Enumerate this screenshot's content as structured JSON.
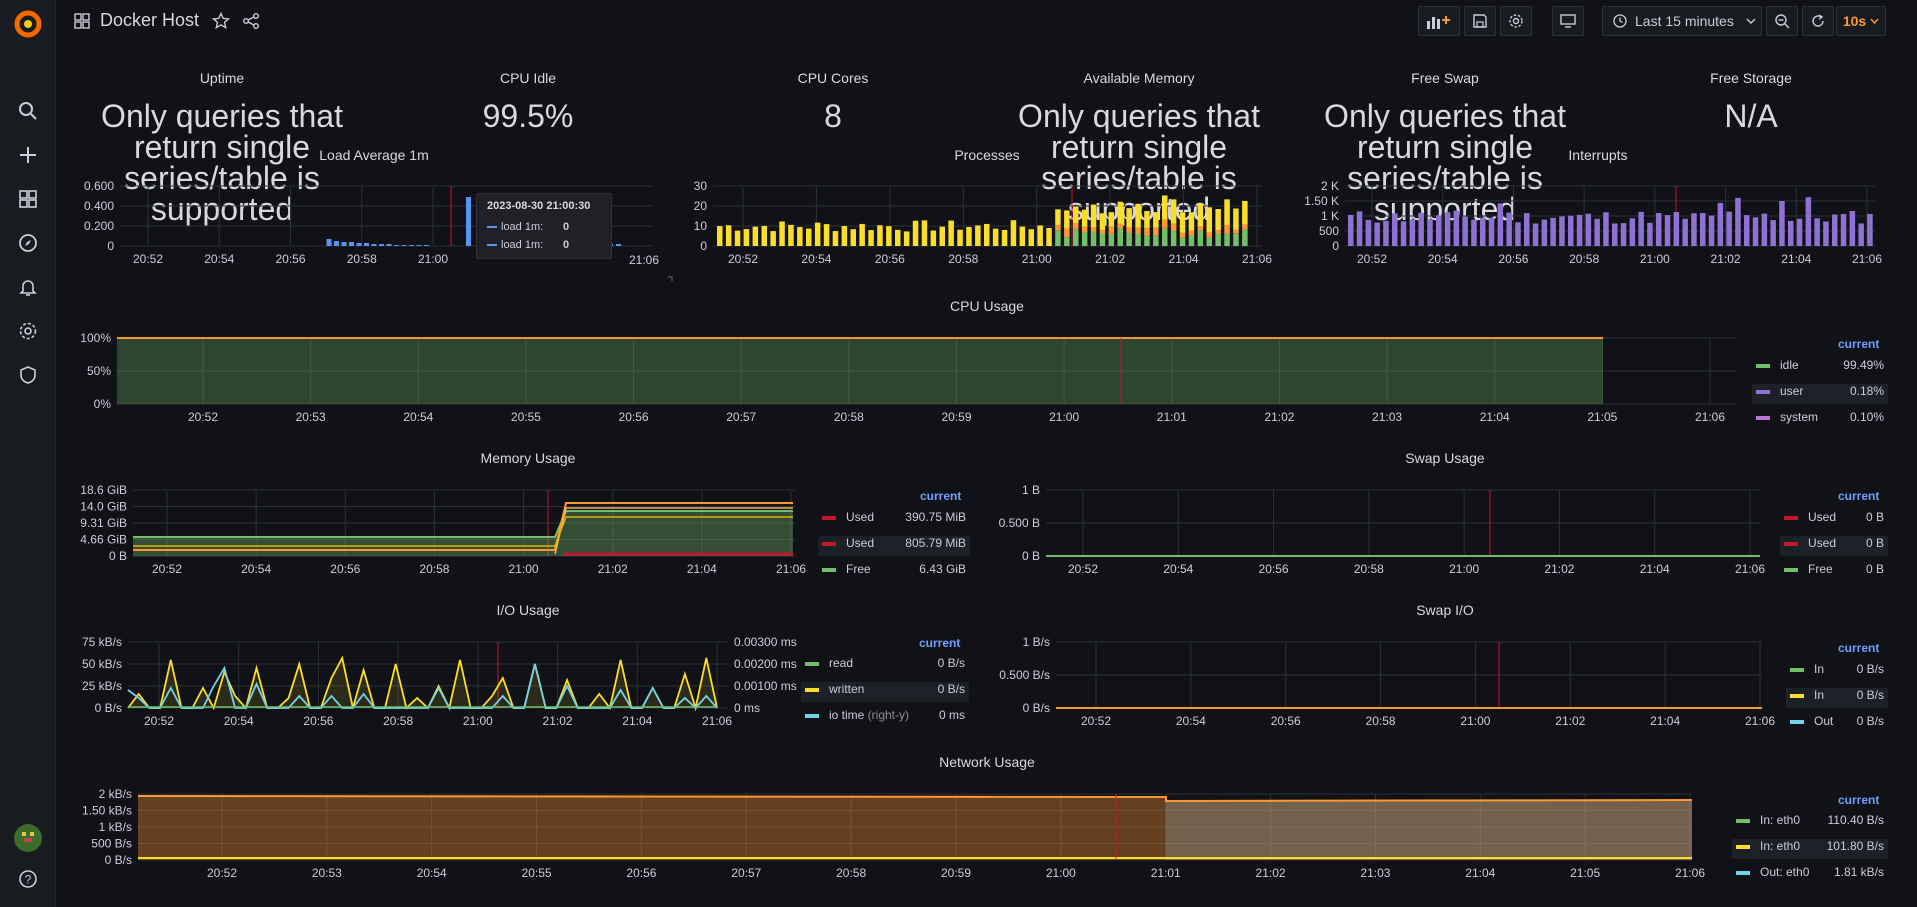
{
  "dashboard": {
    "title": "Docker Host"
  },
  "toolbar": {
    "time_range": "Last 15 minutes",
    "refresh": "10s"
  },
  "colors": {
    "green": "#73bf69",
    "yellow": "#fade2a",
    "orange": "#ff9830",
    "red": "#f2495c",
    "purple": "#8f71d1",
    "blue": "#5794f2",
    "cyan": "#8ab8ff",
    "magenta": "#b877d9",
    "darkred": "#c4162a"
  },
  "stats": {
    "uptime": {
      "title": "Uptime",
      "value": "Only queries that return single series/table is supported"
    },
    "cpu_idle": {
      "title": "CPU Idle",
      "value": "99.5%"
    },
    "cpu_cores": {
      "title": "CPU Cores",
      "value": "8"
    },
    "available_memory": {
      "title": "Available Memory",
      "value": "Only queries that return single series/table is supported"
    },
    "free_swap": {
      "title": "Free Swap",
      "value": "Only queries that return single series/table is supported"
    },
    "free_storage": {
      "title": "Free Storage",
      "value": "N/A"
    }
  },
  "load_panel": {
    "title": "Load Average 1m",
    "y_ticks": [
      "0.600",
      "0.400",
      "0.200",
      "0"
    ],
    "x_ticks": [
      "20:52",
      "20:54",
      "20:56",
      "20:58",
      "21:00"
    ],
    "tooltip": {
      "time": "2023-08-30 21:00:30",
      "rows": [
        {
          "label": "load 1m:",
          "value": "0"
        },
        {
          "label": "load 1m:",
          "value": "0"
        }
      ]
    }
  },
  "processes_panel": {
    "title": "Processes",
    "y_ticks": [
      "30",
      "20",
      "10",
      "0"
    ],
    "x_ticks": [
      "20:52",
      "20:54",
      "20:56",
      "20:58",
      "21:00",
      "21:02",
      "21:04",
      "21:06"
    ]
  },
  "interrupts_panel": {
    "title": "Interrupts",
    "y_ticks": [
      "2 K",
      "1.50 K",
      "1 K",
      "500",
      "0"
    ],
    "x_ticks": [
      "20:52",
      "20:54",
      "20:56",
      "20:58",
      "21:00",
      "21:02",
      "21:04",
      "21:06"
    ]
  },
  "cpu_usage": {
    "title": "CPU Usage",
    "y_ticks": [
      "100%",
      "50%",
      "0%"
    ],
    "x_ticks": [
      "20:52",
      "20:53",
      "20:54",
      "20:55",
      "20:56",
      "20:57",
      "20:58",
      "20:59",
      "21:00",
      "21:01",
      "21:02",
      "21:03",
      "21:04",
      "21:05",
      "21:06"
    ],
    "legend_header": "current",
    "legend": [
      {
        "label": "idle",
        "value": "99.49%",
        "color": "#73bf69"
      },
      {
        "label": "user",
        "value": "0.18%",
        "color": "#8f71d1"
      },
      {
        "label": "system",
        "value": "0.10%",
        "color": "#b877d9"
      }
    ]
  },
  "memory_usage": {
    "title": "Memory Usage",
    "y_ticks": [
      "18.6 GiB",
      "14.0 GiB",
      "9.31 GiB",
      "4.66 GiB",
      "0 B"
    ],
    "x_ticks": [
      "20:52",
      "20:54",
      "20:56",
      "20:58",
      "21:00",
      "21:02",
      "21:04",
      "21:06"
    ],
    "legend_header": "current",
    "legend": [
      {
        "label": "Used",
        "value": "390.75 MiB",
        "color": "#c4162a"
      },
      {
        "label": "Used",
        "value": "805.79 MiB",
        "color": "#c4162a"
      },
      {
        "label": "Free",
        "value": "6.43 GiB",
        "color": "#73bf69"
      }
    ]
  },
  "swap_usage": {
    "title": "Swap Usage",
    "y_ticks": [
      "1 B",
      "0.500 B",
      "0 B"
    ],
    "x_ticks": [
      "20:52",
      "20:54",
      "20:56",
      "20:58",
      "21:00",
      "21:02",
      "21:04",
      "21:06"
    ],
    "legend_header": "current",
    "legend": [
      {
        "label": "Used",
        "value": "0 B",
        "color": "#c4162a"
      },
      {
        "label": "Used",
        "value": "0 B",
        "color": "#c4162a"
      },
      {
        "label": "Free",
        "value": "0 B",
        "color": "#73bf69"
      }
    ]
  },
  "io_usage": {
    "title": "I/O Usage",
    "y_ticks": [
      "75 kB/s",
      "50 kB/s",
      "25 kB/s",
      "0 B/s"
    ],
    "y2_ticks": [
      "0.00300 ms",
      "0.00200 ms",
      "0.00100 ms",
      "0 ms"
    ],
    "x_ticks": [
      "20:52",
      "20:54",
      "20:56",
      "20:58",
      "21:00",
      "21:02",
      "21:04",
      "21:06"
    ],
    "legend_header": "current",
    "legend": [
      {
        "label": "read",
        "value": "0 B/s",
        "color": "#73bf69",
        "suffix": ""
      },
      {
        "label": "written",
        "value": "0 B/s",
        "color": "#fade2a",
        "suffix": ""
      },
      {
        "label": "io time",
        "value": "0 ms",
        "color": "#73d2e8",
        "suffix": "(right-y)"
      }
    ]
  },
  "swap_io": {
    "title": "Swap I/O",
    "y_ticks": [
      "1 B/s",
      "0.500 B/s",
      "0 B/s"
    ],
    "x_ticks": [
      "20:52",
      "20:54",
      "20:56",
      "20:58",
      "21:00",
      "21:02",
      "21:04",
      "21:06"
    ],
    "legend_header": "current",
    "legend": [
      {
        "label": "In",
        "value": "0 B/s",
        "color": "#73bf69"
      },
      {
        "label": "In",
        "value": "0 B/s",
        "color": "#fade2a"
      },
      {
        "label": "Out",
        "value": "0 B/s",
        "color": "#73d2e8"
      }
    ]
  },
  "network_usage": {
    "title": "Network Usage",
    "y_ticks": [
      "2 kB/s",
      "1.50 kB/s",
      "1 kB/s",
      "500 B/s",
      "0 B/s"
    ],
    "x_ticks": [
      "20:52",
      "20:53",
      "20:54",
      "20:55",
      "20:56",
      "20:57",
      "20:58",
      "20:59",
      "21:00",
      "21:01",
      "21:02",
      "21:03",
      "21:04",
      "21:05",
      "21:06"
    ],
    "legend_header": "current",
    "legend": [
      {
        "label": "In: eth0",
        "value": "110.40 B/s",
        "color": "#73bf69"
      },
      {
        "label": "In: eth0",
        "value": "101.80 B/s",
        "color": "#fade2a"
      },
      {
        "label": "Out: eth0",
        "value": "1.81 kB/s",
        "color": "#73d2e8"
      }
    ]
  }
}
